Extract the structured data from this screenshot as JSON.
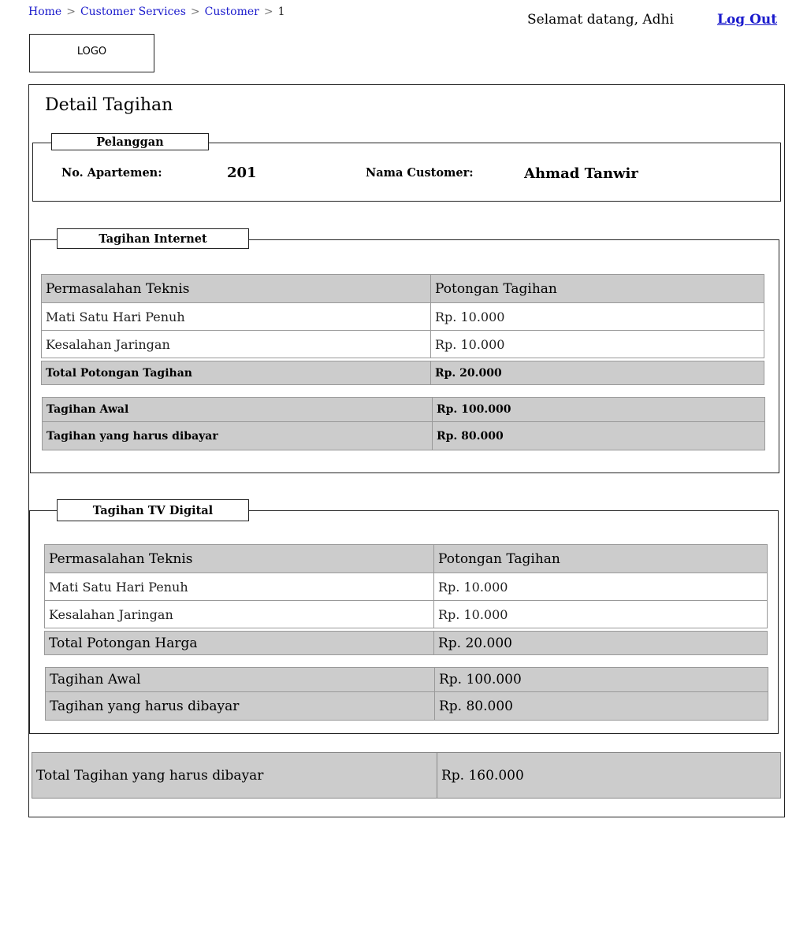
{
  "breadcrumb": {
    "items": [
      "Home",
      "Customer Services",
      "Customer"
    ],
    "separator": ">",
    "current": "1"
  },
  "header": {
    "welcome": "Selamat datang, Adhi",
    "logout": "Log Out",
    "logo": "LOGO"
  },
  "page": {
    "title": "Detail Tagihan"
  },
  "pelanggan": {
    "legend": "Pelanggan",
    "apartment_label": "No. Apartemen:",
    "apartment_value": "201",
    "customer_label": "Nama Customer:",
    "customer_value": "Ahmad Tanwir"
  },
  "internet": {
    "legend": "Tagihan Internet",
    "headers": [
      "Permasalahan Teknis",
      "Potongan Tagihan"
    ],
    "rows": [
      [
        "Mati Satu Hari Penuh",
        "Rp. 10.000"
      ],
      [
        "Kesalahan Jaringan",
        "Rp. 10.000"
      ]
    ],
    "total_label": "Total Potongan Tagihan",
    "total_value": "Rp. 20.000",
    "initial_label": "Tagihan Awal",
    "initial_value": "Rp. 100.000",
    "due_label": "Tagihan yang harus dibayar",
    "due_value": "Rp. 80.000"
  },
  "tv": {
    "legend": "Tagihan TV Digital",
    "headers": [
      "Permasalahan Teknis",
      "Potongan Tagihan"
    ],
    "rows": [
      [
        "Mati Satu Hari Penuh",
        "Rp. 10.000"
      ],
      [
        "Kesalahan Jaringan",
        "Rp. 10.000"
      ]
    ],
    "total_label": "Total Potongan Harga",
    "total_value": "Rp. 20.000",
    "initial_label": "Tagihan Awal",
    "initial_value": "Rp. 100.000",
    "due_label": "Tagihan yang harus dibayar",
    "due_value": "Rp. 80.000"
  },
  "grand_total": {
    "label": "Total Tagihan yang harus dibayar",
    "value": "Rp. 160.000"
  }
}
